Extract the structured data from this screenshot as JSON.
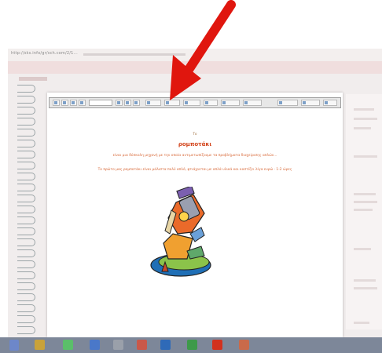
{
  "browser": {
    "url": "http://sks.info/gr/sch.com/2/1..."
  },
  "document": {
    "label": "Το",
    "title": "ρομποτάκι",
    "subtitle": "είναι μια δύσκολη μηχανή με την οποία αντιμετωπίζουμε τα προβλήματα διαχείρισης απλών...",
    "description": "Το πρώτο μας ρομποτάκι είναι μάλιστα πολύ απλό, φτιάχνεται με απλά υλικά και κοστίζει λίγα ευρώ · 1-2 ώρες"
  },
  "colors": {
    "title": "#d2431a",
    "text": "#d86a3a",
    "arrow": "#e0160e",
    "taskbar": "#7d8799"
  },
  "toolbar": {
    "icons": [
      "back-icon",
      "forward-icon",
      "undo-icon",
      "redo-icon",
      "style-dropdown",
      "bold-icon",
      "italic-icon",
      "underline-icon",
      "align-icon",
      "list-icon",
      "image-icon",
      "link-icon",
      "table-icon",
      "color-icon",
      "source-icon",
      "more-icon",
      "help-icon"
    ]
  },
  "taskbar": {
    "apps": [
      "file-explorer-icon",
      "chrome-icon",
      "internet-explorer-icon",
      "word-icon",
      "media-icon",
      "excel-icon",
      "powerpoint-icon",
      "paint-icon"
    ]
  }
}
